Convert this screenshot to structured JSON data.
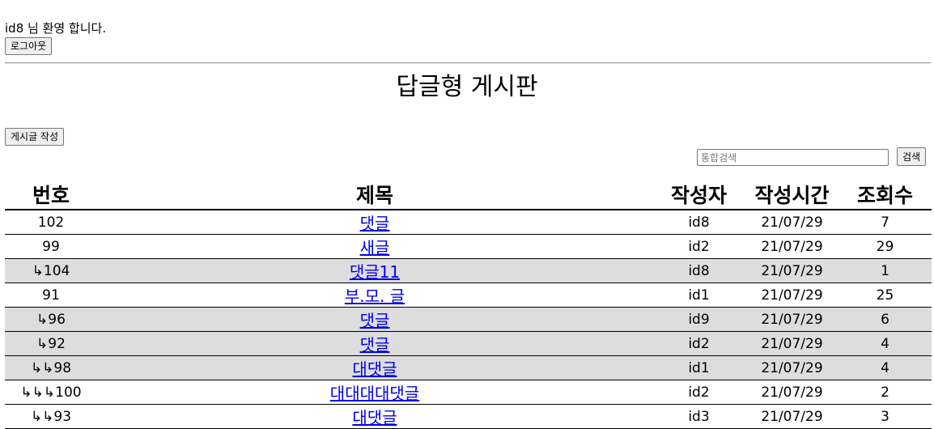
{
  "header": {
    "welcome_text": "id8 님 환영 합니다.",
    "logout_label": "로그아웃"
  },
  "board": {
    "title": "답글형 게시판",
    "write_label": "게시글 작성",
    "search_placeholder": "통합검색",
    "search_label": "검색"
  },
  "table": {
    "columns": [
      "번호",
      "제목",
      "작성자",
      "작성시간",
      "조회수"
    ],
    "rows": [
      {
        "no": "102",
        "title": "댓글",
        "writer": "id8",
        "time": "21/07/29",
        "views": "7",
        "shaded": false
      },
      {
        "no": "99",
        "title": "새글",
        "writer": "id2",
        "time": "21/07/29",
        "views": "29",
        "shaded": false
      },
      {
        "no": "↳104",
        "title": "댓글11",
        "writer": "id8",
        "time": "21/07/29",
        "views": "1",
        "shaded": true
      },
      {
        "no": "91",
        "title": "부.모. 글",
        "writer": "id1",
        "time": "21/07/29",
        "views": "25",
        "shaded": false
      },
      {
        "no": "↳96",
        "title": "댓글",
        "writer": "id9",
        "time": "21/07/29",
        "views": "6",
        "shaded": true
      },
      {
        "no": "↳92",
        "title": "댓글",
        "writer": "id2",
        "time": "21/07/29",
        "views": "4",
        "shaded": true
      },
      {
        "no": "↳↳98",
        "title": "대댓글",
        "writer": "id1",
        "time": "21/07/29",
        "views": "4",
        "shaded": true
      },
      {
        "no": "↳↳↳100",
        "title": "대대대대댓글",
        "writer": "id2",
        "time": "21/07/29",
        "views": "2",
        "shaded": false
      },
      {
        "no": "↳↳93",
        "title": "대댓글",
        "writer": "id3",
        "time": "21/07/29",
        "views": "3",
        "shaded": false
      }
    ]
  }
}
